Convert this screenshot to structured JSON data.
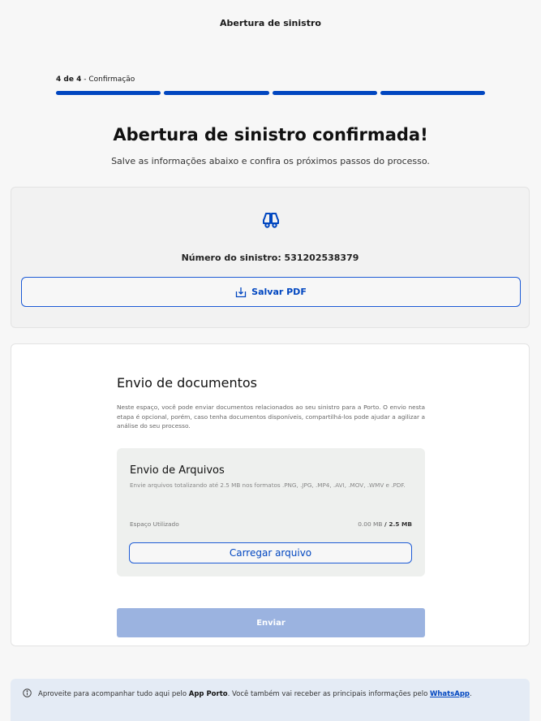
{
  "header": {
    "title": "Abertura de sinistro"
  },
  "progress": {
    "step": "4 de 4",
    "separator": " - ",
    "step_name": "Confirmação",
    "current": 4,
    "total": 4
  },
  "confirmation": {
    "title": "Abertura de sinistro confirmada!",
    "subtitle": "Salve as informações abaixo e confira os próximos passos do processo.",
    "icon": "car-icon",
    "claim_number": "Número do sinistro: 531202538379",
    "pdf_button": "Salvar PDF",
    "pdf_icon": "download-icon"
  },
  "documents": {
    "title": "Envio de documentos",
    "description": "Neste espaço, você pode enviar documentos relacionados ao seu sinistro para a Porto. O envio nesta etapa é opcional, porém, caso tenha documentos disponíveis, compartilhá-los pode ajudar a agilizar a análise do seu processo.",
    "files": {
      "title": "Envio de Arquivos",
      "description": "Envie arquivos totalizando até 2.5 MB nos formatos .PNG, .JPG, .MP4, .AVI, .MOV, .WMV e .PDF.",
      "space_label": "Espaço Utilizado",
      "space_used": "0.00 MB",
      "space_sep": " / ",
      "space_total": "2.5 MB",
      "upload_button": "Carregar arquivo"
    },
    "send_button": "Enviar"
  },
  "info": {
    "icon": "info-icon",
    "text_1": "Aproveite para acompanhar tudo aqui pelo ",
    "app_name": "App Porto",
    "text_2": ". Você também vai receber as principais informações pelo ",
    "whatsapp": "WhatsApp",
    "text_3": "."
  },
  "colors": {
    "accent": "#0046c0",
    "disabled_button": "#9bb3e0",
    "info_bg": "#e4ebf5"
  }
}
